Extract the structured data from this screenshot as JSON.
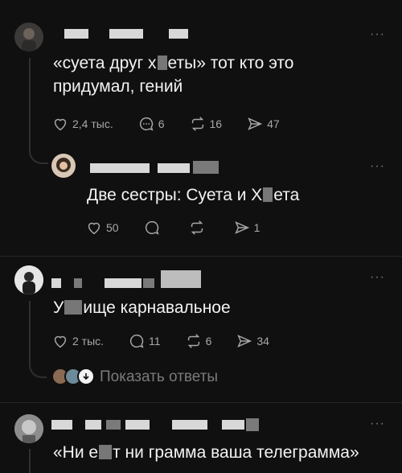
{
  "posts": [
    {
      "text_line1_a": "«суета друг х",
      "text_line1_b": "еты» тот кто это",
      "text_line2": "придумал, гений",
      "likes": "2,4 тыс.",
      "comments": "6",
      "reposts": "16",
      "shares": "47"
    },
    {
      "text_a": "Две сестры: Суета и Х",
      "text_b": "ета",
      "likes": "50",
      "shares": "1"
    },
    {
      "text_a": "У",
      "text_b": "ище карнавальное",
      "likes": "2 тыс.",
      "comments": "11",
      "reposts": "6",
      "shares": "34",
      "show_replies": "Показать ответы"
    },
    {
      "text_a": "«Ни е",
      "text_b": "т ни грамма ваша телеграмма»"
    }
  ],
  "more_glyph": "···",
  "colors": {
    "bg": "#101010",
    "text": "#f3f3f3",
    "muted": "#a8a8a8"
  }
}
